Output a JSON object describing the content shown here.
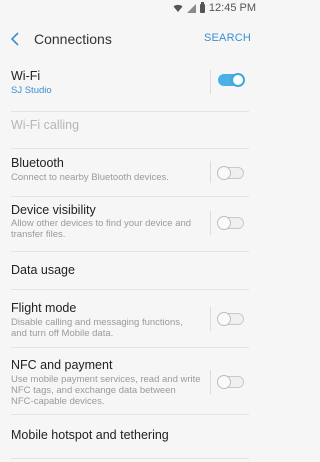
{
  "status": {
    "time": "12:45 PM"
  },
  "header": {
    "title": "Connections",
    "search_label": "SEARCH"
  },
  "items": [
    {
      "label": "Wi-Fi",
      "sub": "SJ Studio",
      "toggle": "on"
    },
    {
      "label": "Wi-Fi calling"
    },
    {
      "label": "Bluetooth",
      "sub": "Connect to nearby Bluetooth devices.",
      "toggle": "off"
    },
    {
      "label": "Device visibility",
      "sub": "Allow other devices to find your device and transfer files.",
      "toggle": "off"
    },
    {
      "label": "Data usage"
    },
    {
      "label": "Flight mode",
      "sub": "Disable calling and messaging functions, and turn off Mobile data.",
      "toggle": "off"
    },
    {
      "label": "NFC and payment",
      "sub": "Use mobile payment services, read and write NFC tags, and exchange data between NFC-capable devices.",
      "toggle": "off"
    },
    {
      "label": "Mobile hotspot and tethering"
    }
  ],
  "colors": {
    "accent": "#3b8fd0",
    "toggle_on": "#4bb0e6"
  }
}
